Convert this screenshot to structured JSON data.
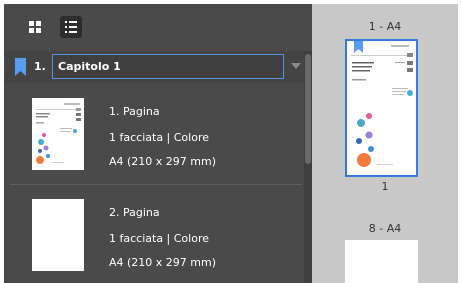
{
  "toolbar": {
    "grid_view_icon": "grid-icon",
    "list_view_icon": "list-icon"
  },
  "chapter": {
    "number": "1.",
    "name": "Capitolo 1",
    "icon": "bookmark-icon"
  },
  "pages": [
    {
      "title": "1. Pagina",
      "info": "1 facciata | Colore",
      "size": "A4 (210 x 297 mm)"
    },
    {
      "title": "2. Pagina",
      "info": "1 facciata | Colore",
      "size": "A4 (210 x 297 mm)"
    }
  ],
  "preview": {
    "label_1": "1 - A4",
    "page_number_1": "1",
    "label_2": "8 - A4"
  },
  "colors": {
    "accent": "#3a78d8",
    "panel_bg": "#4a4a4a",
    "preview_bg": "#c8c8c8"
  }
}
